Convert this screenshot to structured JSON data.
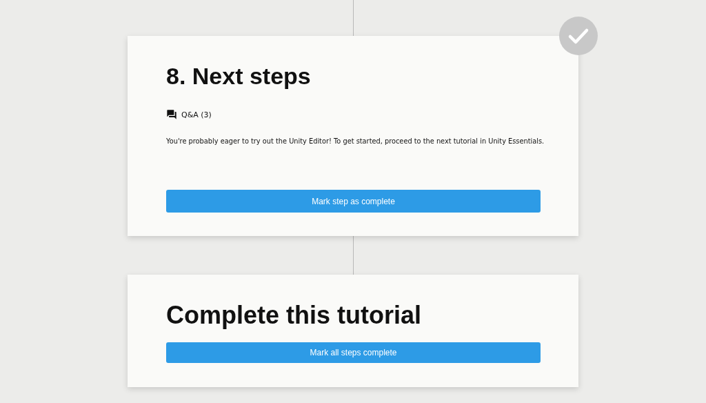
{
  "step": {
    "title": "8. Next steps",
    "completed": false,
    "qa_label": "Q&A (3)",
    "text": "You're probably eager to try out the Unity Editor! To get started, proceed to the next tutorial in Unity Essentials.",
    "button": "Mark step as complete"
  },
  "complete": {
    "title": "Complete this tutorial",
    "button": "Mark all steps complete"
  }
}
